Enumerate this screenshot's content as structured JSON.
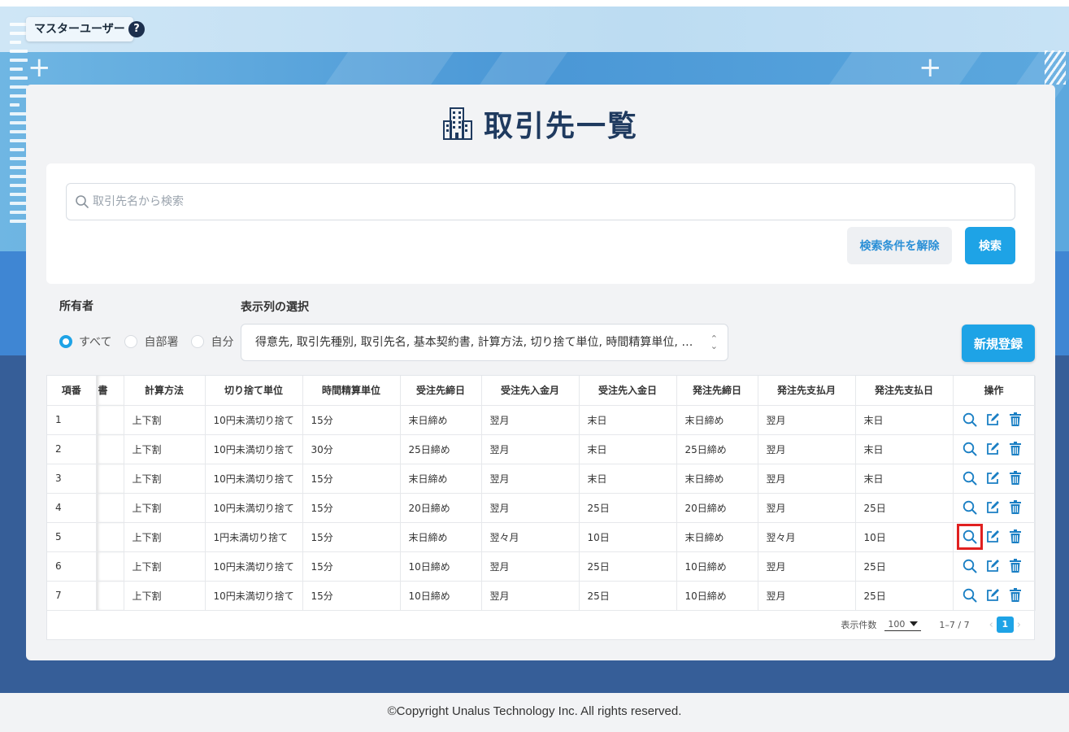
{
  "header": {
    "user_label": "マスターユーザー",
    "help": "?"
  },
  "page": {
    "title": "取引先一覧"
  },
  "search": {
    "placeholder": "取引先名から検索",
    "clear_label": "検索条件を解除",
    "search_label": "検索"
  },
  "filters": {
    "owner_label": "所有者",
    "owner_options": [
      "すべて",
      "自部署",
      "自分"
    ],
    "owner_selected": "すべて",
    "columns_label": "表示列の選択",
    "columns_value": "得意先, 取引先種別, 取引先名, 基本契約書, 計算方法, 切り捨て単位, 時間精算単位, 受注先締日, 受注先入金月, 受注先入金日, 発注先締日, 発注先支払月, 発注先支払日"
  },
  "actions": {
    "new_label": "新規登録"
  },
  "table": {
    "headers": [
      "項番",
      "書",
      "計算方法",
      "切り捨て単位",
      "時間精算単位",
      "受注先締日",
      "受注先入金月",
      "受注先入金日",
      "発注先締日",
      "発注先支払月",
      "発注先支払日",
      "操作"
    ],
    "rows": [
      [
        "1",
        "",
        "上下割",
        "10円未満切り捨て",
        "15分",
        "末日締め",
        "翌月",
        "末日",
        "末日締め",
        "翌月",
        "末日"
      ],
      [
        "2",
        "",
        "上下割",
        "10円未満切り捨て",
        "30分",
        "25日締め",
        "翌月",
        "末日",
        "25日締め",
        "翌月",
        "末日"
      ],
      [
        "3",
        "",
        "上下割",
        "10円未満切り捨て",
        "15分",
        "末日締め",
        "翌月",
        "末日",
        "末日締め",
        "翌月",
        "末日"
      ],
      [
        "4",
        "",
        "上下割",
        "10円未満切り捨て",
        "15分",
        "20日締め",
        "翌月",
        "25日",
        "20日締め",
        "翌月",
        "25日"
      ],
      [
        "5",
        "",
        "上下割",
        "1円未満切り捨て",
        "15分",
        "末日締め",
        "翌々月",
        "10日",
        "末日締め",
        "翌々月",
        "10日"
      ],
      [
        "6",
        "",
        "上下割",
        "10円未満切り捨て",
        "15分",
        "10日締め",
        "翌月",
        "25日",
        "10日締め",
        "翌月",
        "25日"
      ],
      [
        "7",
        "",
        "上下割",
        "10円未満切り捨て",
        "15分",
        "10日締め",
        "翌月",
        "25日",
        "10日締め",
        "翌月",
        "25日"
      ]
    ],
    "row_icons": [
      "search-icon",
      "edit-icon",
      "trash-icon"
    ],
    "highlight_row": 5
  },
  "pager": {
    "label": "表示件数",
    "size": "100",
    "range": "1–7 / 7",
    "current": "1",
    "prev": "‹",
    "next": "›"
  },
  "footer": {
    "copyright": "©Copyright Unalus Technology Inc. All rights reserved."
  },
  "colors": {
    "accent": "#1ea3e6",
    "title": "#1f3a5f",
    "highlight": "#e02020",
    "icon": "#1a7fc4"
  }
}
